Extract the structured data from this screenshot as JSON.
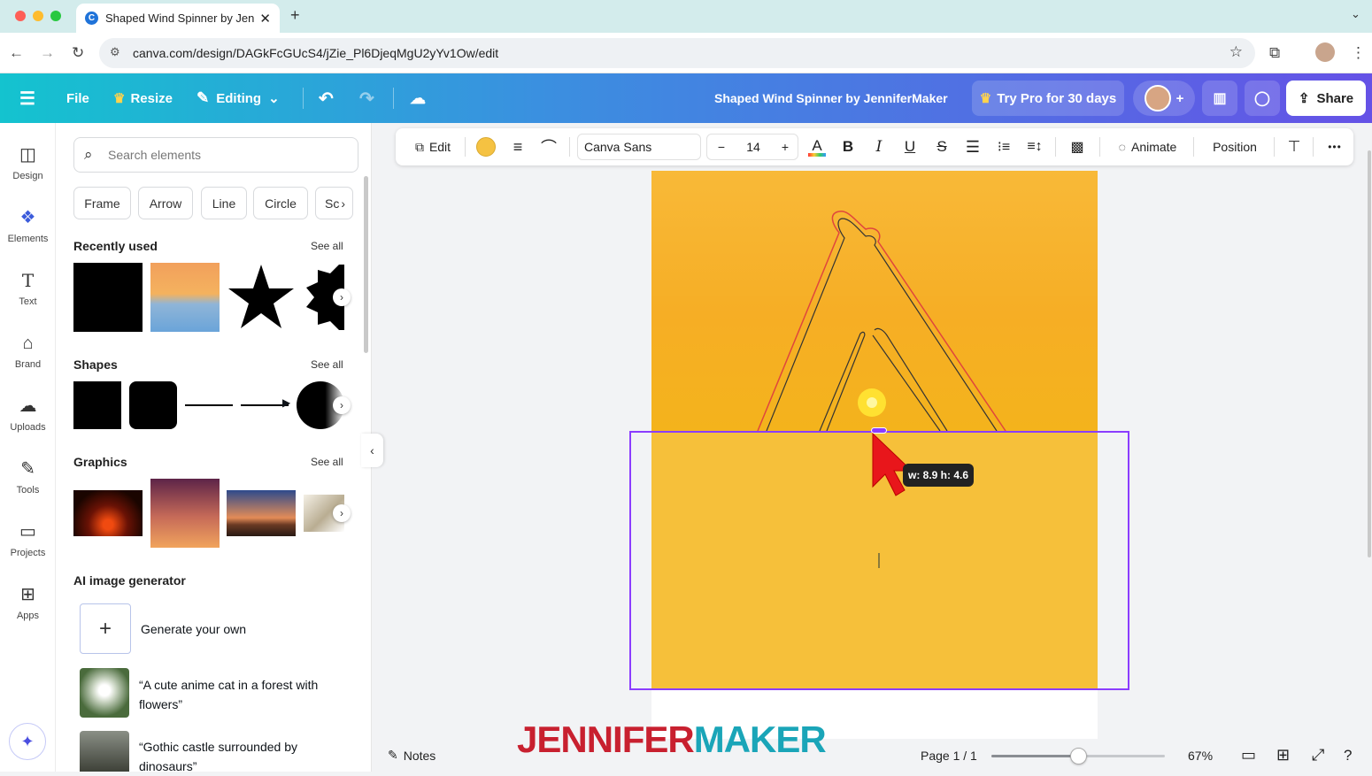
{
  "browser": {
    "tab_title": "Shaped Wind Spinner by Jen",
    "new_tab": "+",
    "url": "canva.com/design/DAGkFcGUcS4/jZie_Pl6DjeqMgU2yYv1Ow/edit"
  },
  "header": {
    "file": "File",
    "resize": "Resize",
    "editing": "Editing",
    "title": "Shaped Wind Spinner by JenniferMaker",
    "try_pro": "Try Pro for 30 days",
    "share": "Share"
  },
  "rail": [
    {
      "label": "Design",
      "icon": "design-icon"
    },
    {
      "label": "Elements",
      "icon": "elements-icon"
    },
    {
      "label": "Text",
      "icon": "text-icon"
    },
    {
      "label": "Brand",
      "icon": "brand-icon"
    },
    {
      "label": "Uploads",
      "icon": "uploads-icon"
    },
    {
      "label": "Tools",
      "icon": "tools-icon"
    },
    {
      "label": "Projects",
      "icon": "projects-icon"
    },
    {
      "label": "Apps",
      "icon": "apps-icon"
    }
  ],
  "panel": {
    "search_placeholder": "Search elements",
    "chips": [
      "Frame",
      "Arrow",
      "Line",
      "Circle",
      "Sc"
    ],
    "recently_used": "Recently used",
    "shapes": "Shapes",
    "graphics": "Graphics",
    "see_all": "See all",
    "ai_title": "AI image generator",
    "generate": "Generate your own",
    "prompt1": "“A cute anime cat in a forest with flowers”",
    "prompt2": "“Gothic castle surrounded by dinosaurs”"
  },
  "toolbar": {
    "edit": "Edit",
    "font": "Canva Sans",
    "minus": "−",
    "size": "14",
    "plus": "+",
    "bold": "B",
    "italic": "I",
    "underline": "U",
    "strike": "S",
    "animate": "Animate",
    "position": "Position",
    "more": "•••",
    "fill_color": "#f5c242"
  },
  "canvas": {
    "size_tip": "w: 8.9 h: 4.6",
    "watermark_a": "JENNIFER",
    "watermark_b": "MAKER"
  },
  "footer": {
    "notes": "Notes",
    "page": "Page 1 / 1",
    "zoom": "67%",
    "zoom_level": 0.5
  },
  "colors": {
    "accent": "#8b3dff",
    "watermark_red": "#c8202f",
    "watermark_teal": "#1aa5b8"
  }
}
